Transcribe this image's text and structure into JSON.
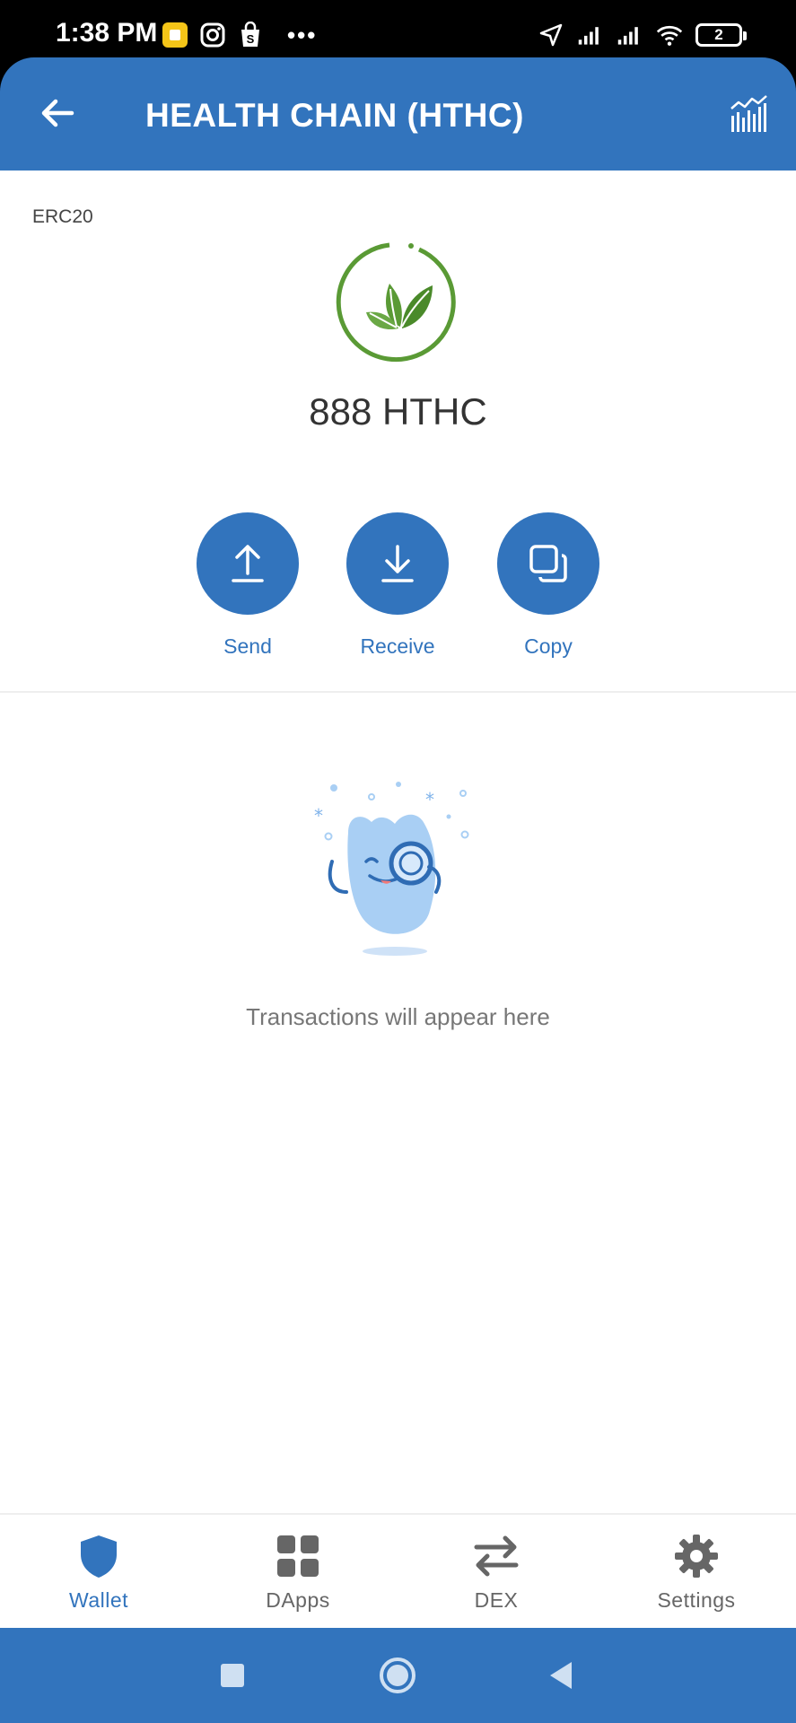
{
  "status_bar": {
    "time": "1:38 PM",
    "battery": "2",
    "icons": [
      "notification-app-icon",
      "instagram-icon",
      "shop-icon",
      "more-dots-icon",
      "location-arrow-icon",
      "signal-icon",
      "signal-icon",
      "wifi-icon",
      "battery-icon"
    ]
  },
  "app_bar": {
    "title": "HEALTH CHAIN (HTHC)",
    "back_icon": "arrow-left-icon",
    "chart_icon": "chart-icon"
  },
  "token": {
    "standard": "ERC20",
    "balance": "888 HTHC",
    "logo_icon": "leaf-logo-icon"
  },
  "actions": [
    {
      "label": "Send",
      "icon": "upload-icon"
    },
    {
      "label": "Receive",
      "icon": "download-icon"
    },
    {
      "label": "Copy",
      "icon": "copy-icon"
    }
  ],
  "empty_state": {
    "text": "Transactions will appear here",
    "illustration": "mascot-magnifier-illustration"
  },
  "bottom_nav": {
    "items": [
      {
        "label": "Wallet",
        "icon": "shield-icon",
        "active": true
      },
      {
        "label": "DApps",
        "icon": "grid-icon",
        "active": false
      },
      {
        "label": "DEX",
        "icon": "swap-icon",
        "active": false
      },
      {
        "label": "Settings",
        "icon": "gear-icon",
        "active": false
      }
    ]
  },
  "system_nav": [
    "recents-square-icon",
    "home-circle-icon",
    "back-triangle-icon"
  ],
  "colors": {
    "primary": "#3274bd",
    "logo_green": "#5a9a35",
    "inactive": "#666666"
  }
}
